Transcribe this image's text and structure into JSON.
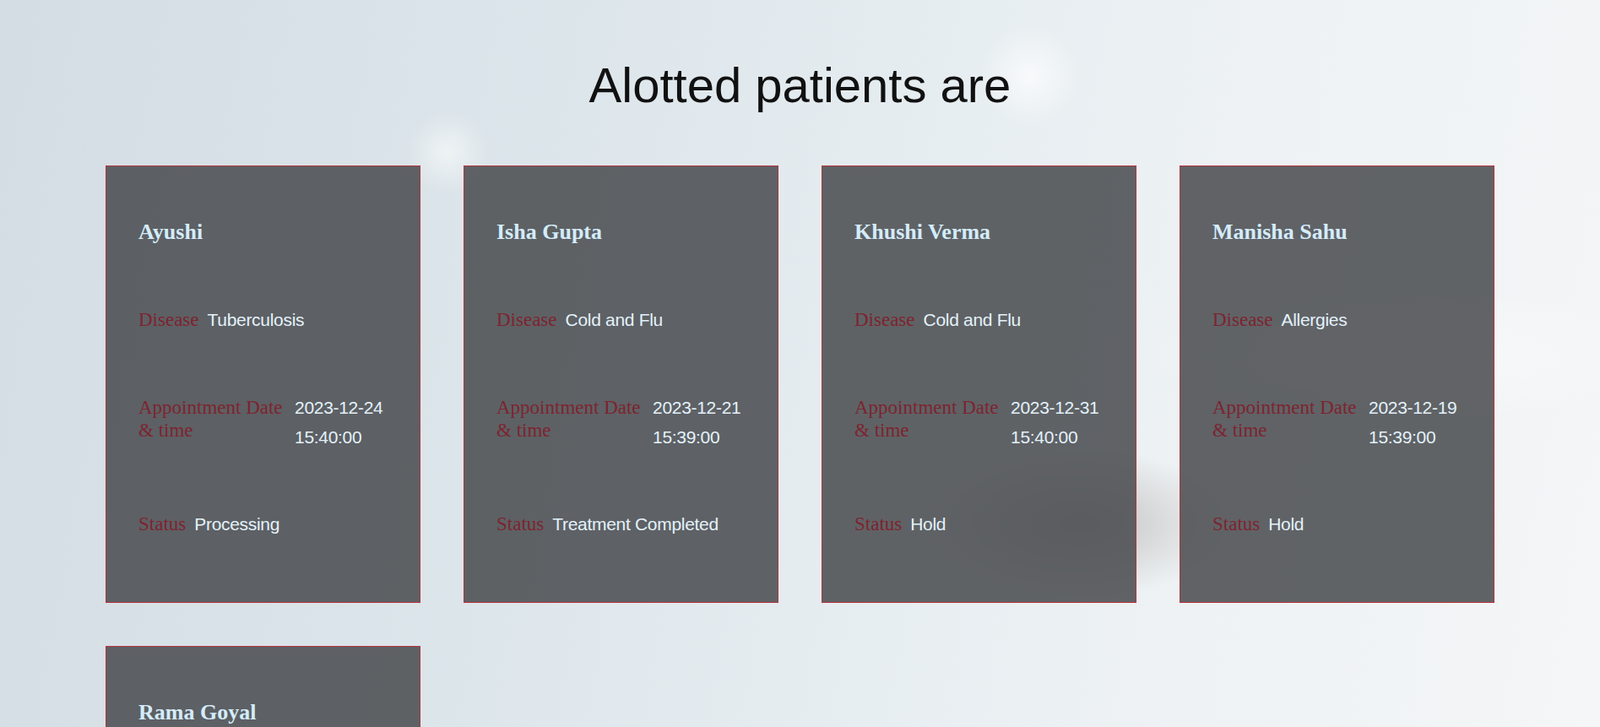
{
  "heading": "Alotted patients are",
  "labels": {
    "disease": "Disease",
    "appointment": "Appointment Date & time",
    "status": "Status"
  },
  "patients": [
    {
      "name": "Ayushi",
      "disease": "Tuberculosis",
      "date": "2023-12-24",
      "time": "15:40:00",
      "status": "Processing"
    },
    {
      "name": "Isha Gupta",
      "disease": "Cold and Flu",
      "date": "2023-12-21",
      "time": "15:39:00",
      "status": "Treatment Completed"
    },
    {
      "name": "Khushi Verma",
      "disease": "Cold and Flu",
      "date": "2023-12-31",
      "time": "15:40:00",
      "status": "Hold"
    },
    {
      "name": "Manisha Sahu",
      "disease": "Allergies",
      "date": "2023-12-19",
      "time": "15:39:00",
      "status": "Hold"
    },
    {
      "name": "Rama Goyal"
    }
  ]
}
